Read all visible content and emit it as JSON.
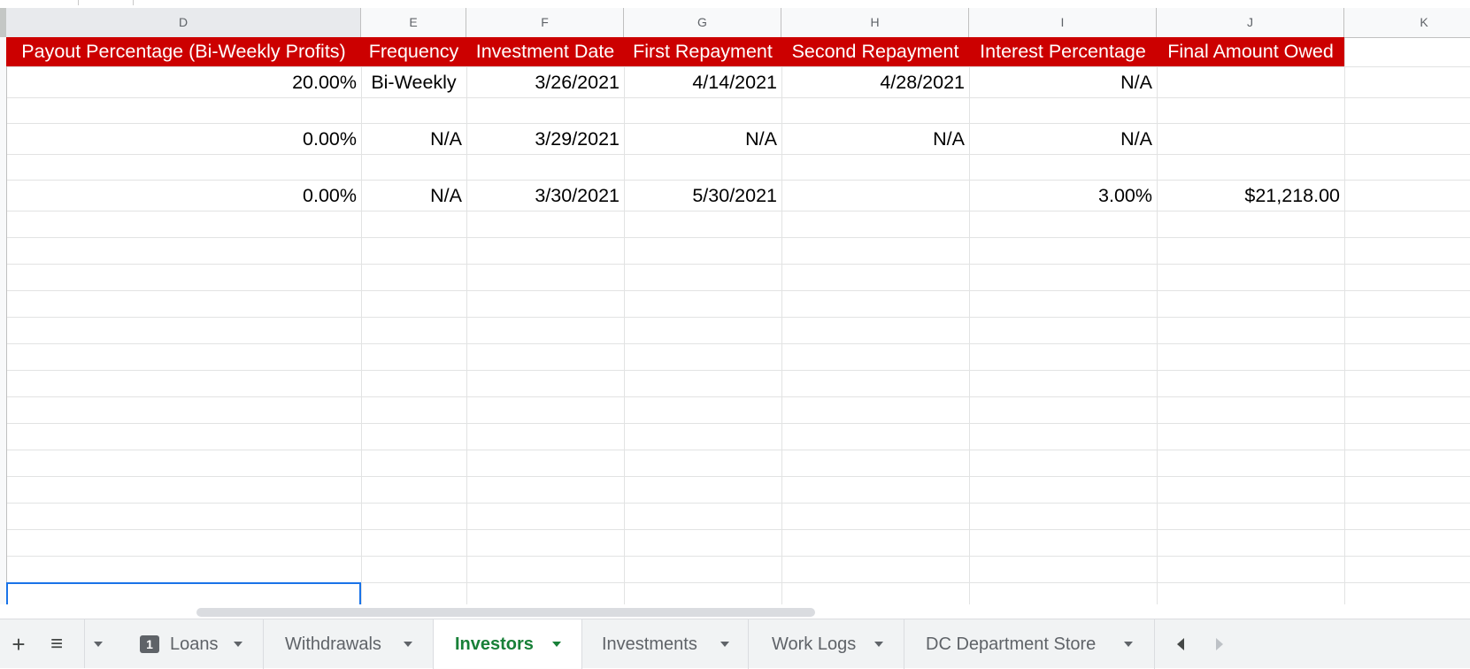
{
  "columns": [
    {
      "letter": "D",
      "x": 0
    },
    {
      "letter": "E"
    },
    {
      "letter": "F"
    },
    {
      "letter": "G"
    },
    {
      "letter": "H"
    },
    {
      "letter": "I"
    },
    {
      "letter": "J"
    },
    {
      "letter": "K"
    }
  ],
  "header_row": {
    "payout": "Payout Percentage (Bi-Weekly Profits)",
    "frequency": "Frequency",
    "investment_date": "Investment Date",
    "first_repayment": "First Repayment",
    "second_repayment": "Second Repayment",
    "interest": "Interest Percentage",
    "final_amount": "Final Amount Owed"
  },
  "rows": [
    {
      "payout": "20.00%",
      "frequency": "Bi-Weekly",
      "investment_date": "3/26/2021",
      "first_repayment": "4/14/2021",
      "second_repayment": "4/28/2021",
      "interest": "N/A",
      "final_amount": ""
    },
    {
      "payout": "0.00%",
      "frequency": "N/A",
      "investment_date": "3/29/2021",
      "first_repayment": "N/A",
      "second_repayment": "N/A",
      "interest": "N/A",
      "final_amount": ""
    },
    {
      "payout": "0.00%",
      "frequency": "N/A",
      "investment_date": "3/30/2021",
      "first_repayment": "5/30/2021",
      "second_repayment": "",
      "interest": "3.00%",
      "final_amount": "$21,218.00"
    }
  ],
  "tabs": [
    {
      "label": "Loans",
      "badge": "1"
    },
    {
      "label": "Withdrawals"
    },
    {
      "label": "Investors",
      "active": true
    },
    {
      "label": "Investments"
    },
    {
      "label": "Work Logs"
    },
    {
      "label": "DC Department Store"
    }
  ],
  "icons": {
    "add_sheet": "plus-icon",
    "all_sheets": "list-icon",
    "menu": "dropdown-caret-icon",
    "scroll_left": "left-arrow-icon",
    "scroll_right": "right-arrow-icon"
  },
  "colors": {
    "header_fill": "#cc0000",
    "header_text": "#ffffff",
    "active_tab": "#188038",
    "selection": "#1a73e8"
  }
}
